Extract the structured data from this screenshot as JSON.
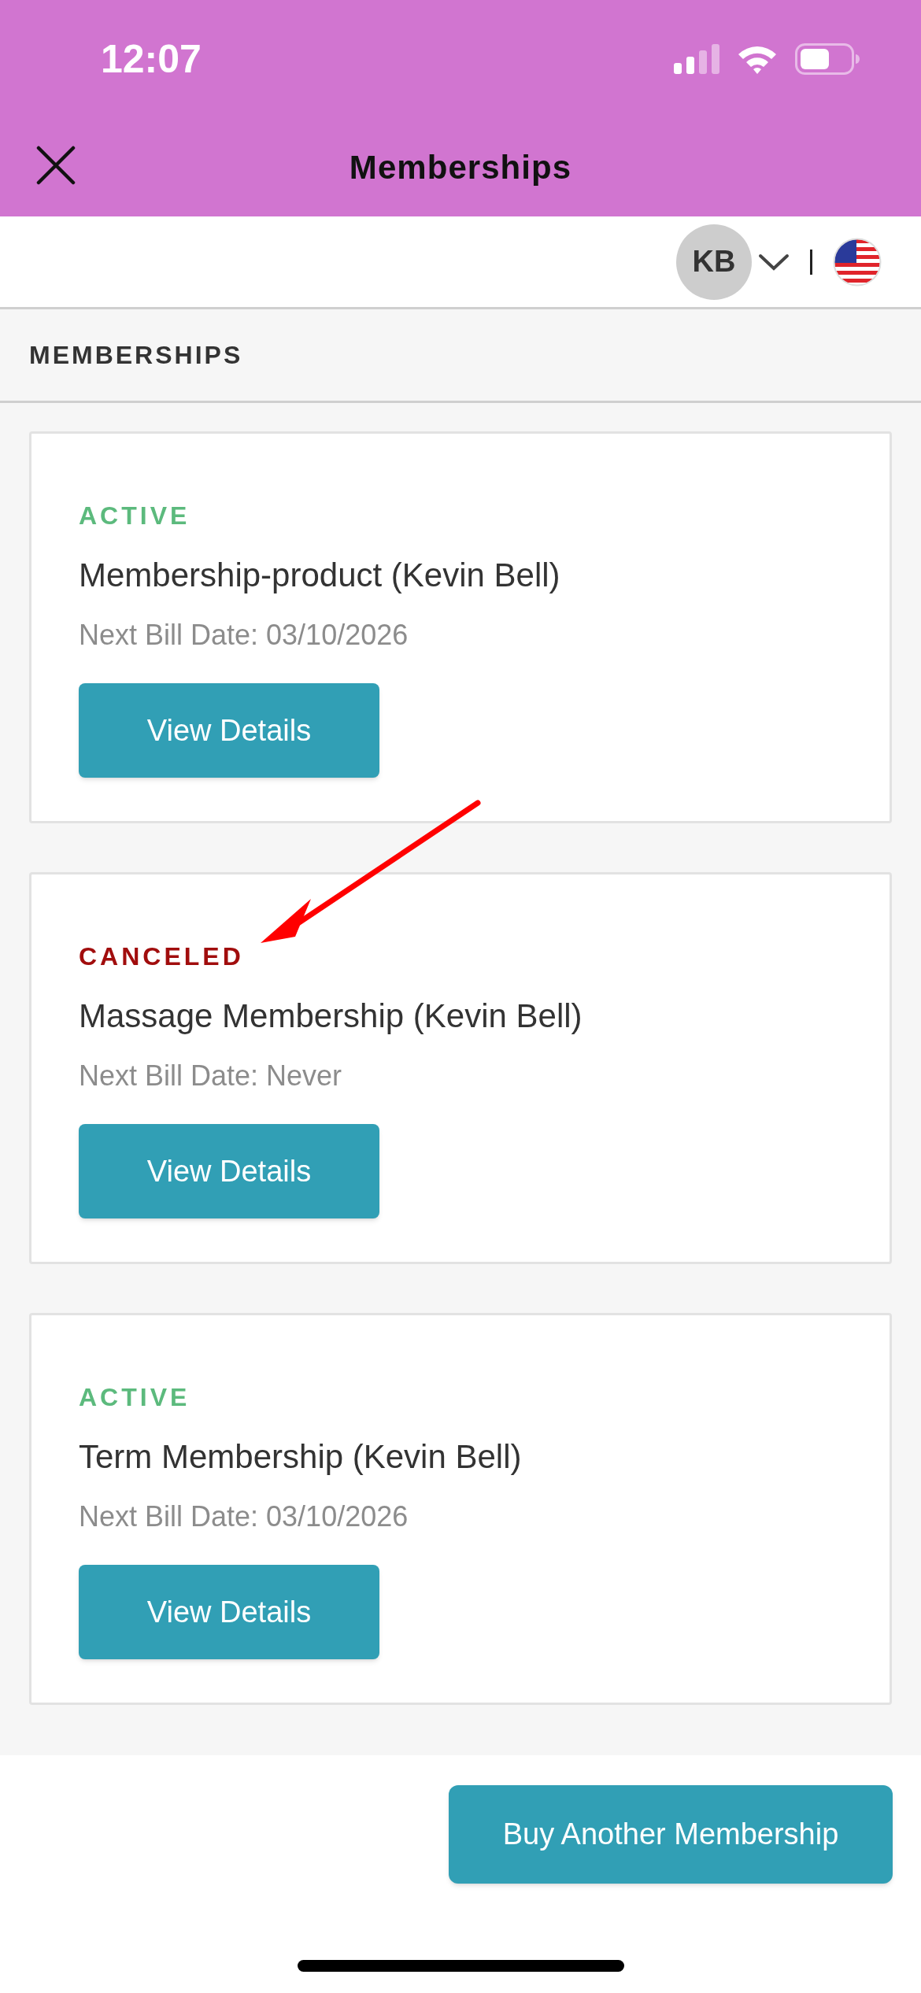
{
  "status_bar": {
    "time": "12:07"
  },
  "header": {
    "title": "Memberships"
  },
  "account": {
    "initials": "KB"
  },
  "section": {
    "title": "MEMBERSHIPS"
  },
  "memberships": [
    {
      "status": "ACTIVE",
      "kind": "active",
      "name": "Membership-product (Kevin Bell)",
      "next_bill": "Next Bill Date: 03/10/2026",
      "button": "View Details"
    },
    {
      "status": "CANCELED",
      "kind": "canceled",
      "name": "Massage Membership (Kevin Bell)",
      "next_bill": "Next Bill Date: Never",
      "button": "View Details"
    },
    {
      "status": "ACTIVE",
      "kind": "active",
      "name": "Term Membership (Kevin Bell)",
      "next_bill": "Next Bill Date: 03/10/2026",
      "button": "View Details"
    }
  ],
  "footer": {
    "button": "Buy Another Membership"
  }
}
